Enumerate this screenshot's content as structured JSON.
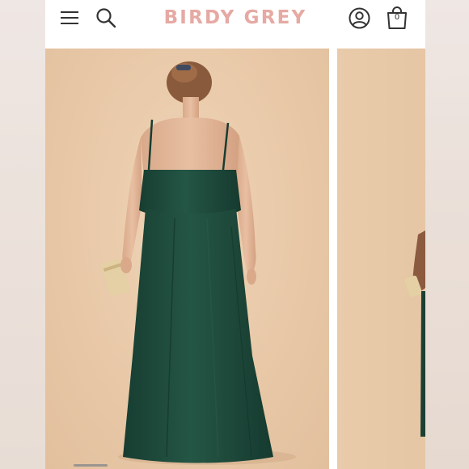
{
  "header": {
    "brand": "BIRDY GREY",
    "cart_count": "0",
    "icons": [
      "menu-icon",
      "search-icon",
      "account-icon",
      "shopping-bag-icon"
    ]
  },
  "gallery": {
    "slides": 2,
    "current": 1,
    "dress_color": "#1f4a3c",
    "background_color": "#e8c8a7"
  },
  "colors": {
    "brand": "#e6a9a3",
    "icon": "#333333"
  }
}
